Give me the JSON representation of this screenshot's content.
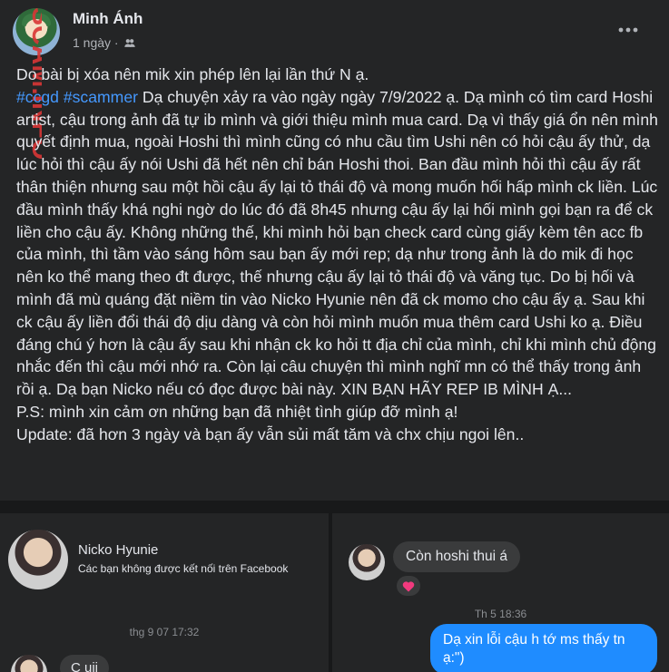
{
  "post": {
    "author": "Minh Ánh",
    "time": "1 ngày ·",
    "privacy_icon": "friends-globe-icon",
    "more_icon": "more-horizontal-icon",
    "watermark": "SCAM.INFO",
    "lines": [
      "Do bài bị xóa nên mik xin phép lên lại lần thứ N ạ.",
      "Dạ chuyện xảy ra vào ngày ngày 7/9/2022 ạ. Dạ mình có tìm card Hoshi artist, cậu trong ảnh đã tự ib mình và giới thiệu mình mua card. Dạ vì thấy giá ổn nên mình quyết định mua, ngoài Hoshi thì mình cũng có nhu cầu tìm Ushi nên có hỏi cậu ấy thử, dạ lúc hỏi thì cậu ấy nói Ushi đã hết nên chỉ bán Hoshi thoi. Ban đầu mình hỏi thì cậu ấy rất thân thiện nhưng sau một hồi cậu ấy lại tỏ thái độ và mong muốn hối hấp mình ck liền. Lúc đầu mình thấy khá nghi ngờ do lúc đó đã 8h45 nhưng cậu ấy lại hối mình gọi bạn ra để ck liền cho cậu ấy. Không những thế, khi mình hỏi bạn check card cùng giấy kèm tên acc fb của mình, thì tầm vào sáng hôm sau bạn ấy mới rep; dạ như trong ảnh là do mik đi học nên ko thể mang theo đt được, thế nhưng cậu ấy lại tỏ thái độ và văng tục. Do bị hối và mình đã mù quáng đặt niềm tin vào Nicko Hyunie nên đã ck momo cho cậu ấy ạ. Sau khi ck cậu ấy liền đổi thái độ dịu dàng và còn hỏi mình muốn mua thêm card Ushi ko ạ. Điều đáng chú ý hơn là cậu ấy sau khi nhận ck ko hỏi tt địa chỉ của mình, chỉ khi mình chủ động nhắc đến thì cậu mới nhớ ra. Còn lại câu chuyện thì mình nghĩ mn có thể thấy trong ảnh rồi ạ. Dạ bạn Nicko nếu có đọc được bài này. XIN BẠN HÃY REP IB MÌNH Ạ...",
      "P.S: mình xin cảm ơn những bạn đã nhiệt tình giúp đỡ mình ạ!",
      "Update: đã hơn 3 ngày và bạn ấy vẫn sủi mất tăm và chx chịu ngoi lên.."
    ],
    "hashtags": [
      "#ccgd",
      "#scammer"
    ]
  },
  "screenshot_left": {
    "contact_name": "Nicko Hyunie",
    "contact_status": "Các bạn không được kết nối trên Facebook",
    "timestamp": "thg 9 07 17:32",
    "message": "C uii"
  },
  "screenshot_right": {
    "incoming_message": "Còn hoshi thui á",
    "reaction_icon": "heart-reaction-icon",
    "timestamp": "Th 5 18:36",
    "outgoing_message": "Dạ xin lỗi cậu h tớ ms thấy tn ạ:\")"
  },
  "colors": {
    "background": "#242526",
    "hashtag": "#4599ff",
    "outgoing_bubble": "#1f8cff",
    "incoming_bubble": "#3a3b3c",
    "watermark": "#d93636"
  }
}
